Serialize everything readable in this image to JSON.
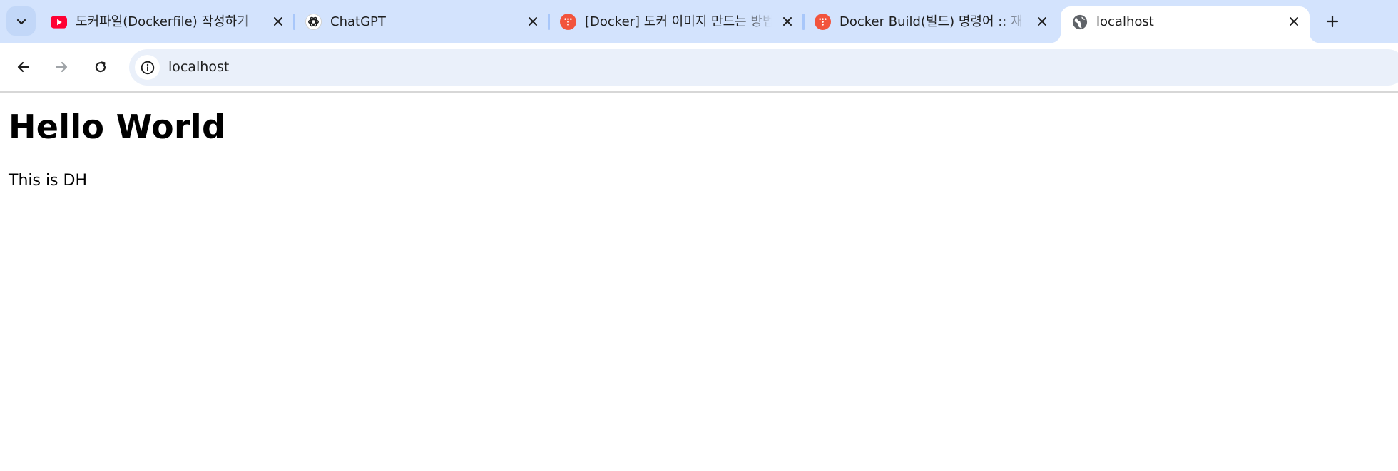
{
  "tabs": [
    {
      "title": "도커파일(Dockerfile) 작성하기",
      "favicon": "youtube-icon",
      "active": false
    },
    {
      "title": "ChatGPT",
      "favicon": "chatgpt-icon",
      "active": false
    },
    {
      "title": "[Docker] 도커 이미지 만드는 방법",
      "favicon": "tistory-icon",
      "active": false
    },
    {
      "title": "Docker Build(빌드) 명령어 :: 재",
      "favicon": "tistory-icon",
      "active": false
    },
    {
      "title": "localhost",
      "favicon": "globe-icon",
      "active": true
    }
  ],
  "address_bar": {
    "url": "localhost"
  },
  "page": {
    "heading": "Hello World",
    "paragraph": "This is DH"
  },
  "colors": {
    "tabstrip_bg": "#d3e3fd",
    "omnibox_bg": "#eaf0fa",
    "youtube_red": "#ff0033",
    "tistory_orange": "#f2543d"
  }
}
